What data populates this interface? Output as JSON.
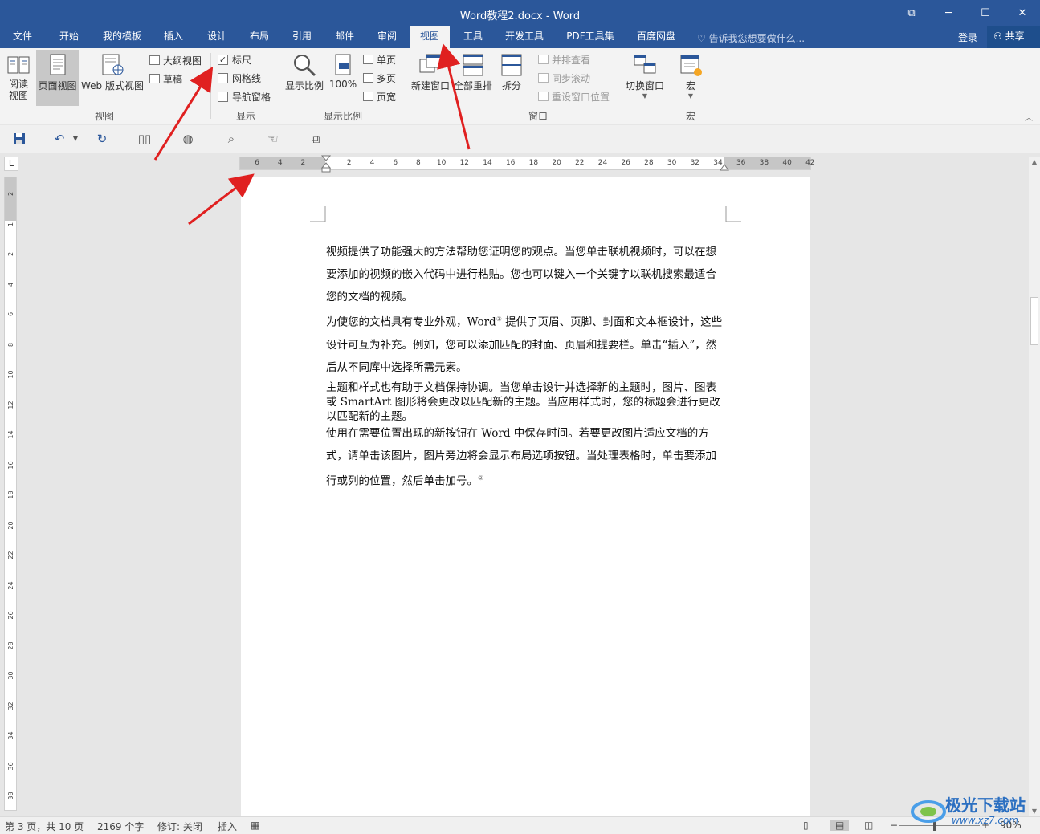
{
  "window": {
    "title": "Word教程2.docx - Word",
    "controls": [
      "⧉",
      "─",
      "☐",
      "✕"
    ]
  },
  "tabs": [
    {
      "label": "文件"
    },
    {
      "label": "开始"
    },
    {
      "label": "我的模板"
    },
    {
      "label": "插入"
    },
    {
      "label": "设计"
    },
    {
      "label": "布局"
    },
    {
      "label": "引用"
    },
    {
      "label": "邮件"
    },
    {
      "label": "审阅"
    },
    {
      "label": "视图",
      "active": true
    },
    {
      "label": "工具"
    },
    {
      "label": "开发工具"
    },
    {
      "label": "PDF工具集"
    },
    {
      "label": "百度网盘"
    }
  ],
  "tell_me": "告诉我您想要做什么...",
  "signin": "登录",
  "share": "共享",
  "ribbon": {
    "views": {
      "label": "视图",
      "read": "阅读\n视图",
      "print": "页面视图",
      "web": "Web 版式视图",
      "outline": "大纲视图",
      "draft": "草稿"
    },
    "show": {
      "label": "显示",
      "ruler": "标尺",
      "ruler_checked": "✓",
      "gridlines": "网格线",
      "nav_pane": "导航窗格"
    },
    "zoom": {
      "label": "显示比例",
      "zoom": "显示比例",
      "hundred": "100%",
      "one_page": "单页",
      "multi_page": "多页",
      "page_width": "页宽"
    },
    "window": {
      "label": "窗口",
      "new_window": "新建窗口",
      "arrange_all": "全部重排",
      "split": "拆分",
      "side_by_side": "并排查看",
      "sync_scroll": "同步滚动",
      "reset_pos": "重设窗口位置",
      "switch": "切换窗口"
    },
    "macros": {
      "label": "宏",
      "macros": "宏"
    }
  },
  "ruler": {
    "h_ticks": [
      "6",
      "4",
      "2",
      "2",
      "4",
      "6",
      "8",
      "10",
      "12",
      "14",
      "16",
      "18",
      "20",
      "22",
      "24",
      "26",
      "28",
      "30",
      "32",
      "34",
      "36",
      "38",
      "40",
      "42"
    ],
    "v_ticks": [
      "2",
      "1",
      "2",
      "4",
      "6",
      "8",
      "10",
      "12",
      "14",
      "16",
      "18",
      "20",
      "22",
      "24",
      "26",
      "28",
      "30",
      "32",
      "34",
      "36",
      "38"
    ],
    "tab_selector": "L"
  },
  "document": {
    "p1": "视频提供了功能强大的方法帮助您证明您的观点。当您单击联机视频时，可以在想要添加的视频的嵌入代码中进行粘贴。您也可以键入一个关键字以联机搜索最适合您的文档的视频。",
    "p2a": "为使您的文档具有专业外观，Word",
    "p2_fn": "①",
    "p2b": " 提供了页眉、页脚、封面和文本框设计，这些设计可互为补充。例如，您可以添加匹配的封面、页眉和提要栏。单击“插入”，然后从不同库中选择所需元素。",
    "p3": "主题和样式也有助于文档保持协调。当您单击设计并选择新的主题时，图片、图表或 SmartArt 图形将会更改以匹配新的主题。当应用样式时，您的标题会进行更改以匹配新的主题。",
    "p4": "使用在需要位置出现的新按钮在 Word 中保存时间。若要更改图片适应文档的方式，请单击该图片，图片旁边将会显示布局选项按钮。当处理表格时，单击要添加行或列的位置，然后单击加号。",
    "p4_fn": "②"
  },
  "status": {
    "page": "第 3 页，共 10 页",
    "words": "2169 个字",
    "track": "修订: 关闭",
    "insert": "插入",
    "zoom": "90%"
  },
  "watermark": {
    "title": "极光下载站",
    "url": "www.xz7.com"
  },
  "colors": {
    "accent": "#2b579a",
    "arrow": "#e02020"
  }
}
